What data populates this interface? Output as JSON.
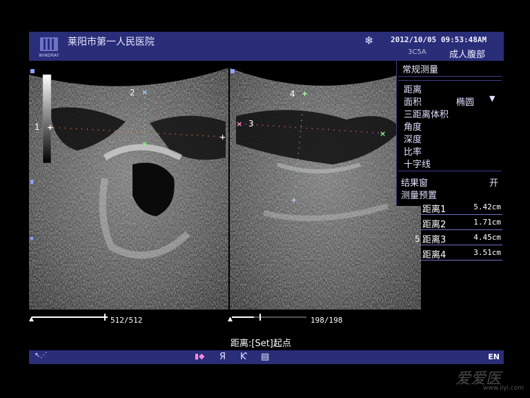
{
  "header": {
    "logo_text": "WINDRAY",
    "hospital": "莱阳市第一人民医院",
    "datetime": "2012/10/05  09:53:48AM",
    "probe": "3C5A",
    "preset": "成人腹部"
  },
  "menu": {
    "title": "常规测量",
    "items": [
      "距离",
      "面积",
      "三距离体积",
      "角度",
      "深度",
      "比率",
      "十字线"
    ],
    "area_option": "椭圆",
    "result_window_label": "结果窗",
    "result_window_value": "开",
    "preset_label": "测量预置"
  },
  "results": [
    {
      "label": "距离1",
      "value": "5.42cm"
    },
    {
      "label": "距离2",
      "value": "1.71cm"
    },
    {
      "label": "距离3",
      "value": "4.45cm"
    },
    {
      "label": "距离4",
      "value": "3.51cm"
    }
  ],
  "markers": {
    "m1": "1",
    "m2": "2",
    "m3": "3",
    "m4": "4",
    "m5": "5"
  },
  "cine": {
    "left_frames": "512/512",
    "right_frames": "198/198",
    "left_progress": 1.0,
    "right_progress": 0.3
  },
  "prompt": "距离:[Set]起点",
  "statusbar": {
    "language": "EN"
  },
  "watermark": {
    "brand": "爱爱医",
    "url": "www.iiyi.com"
  },
  "colors": {
    "panel": "#2a2d78",
    "accent": "#6f73c9"
  }
}
